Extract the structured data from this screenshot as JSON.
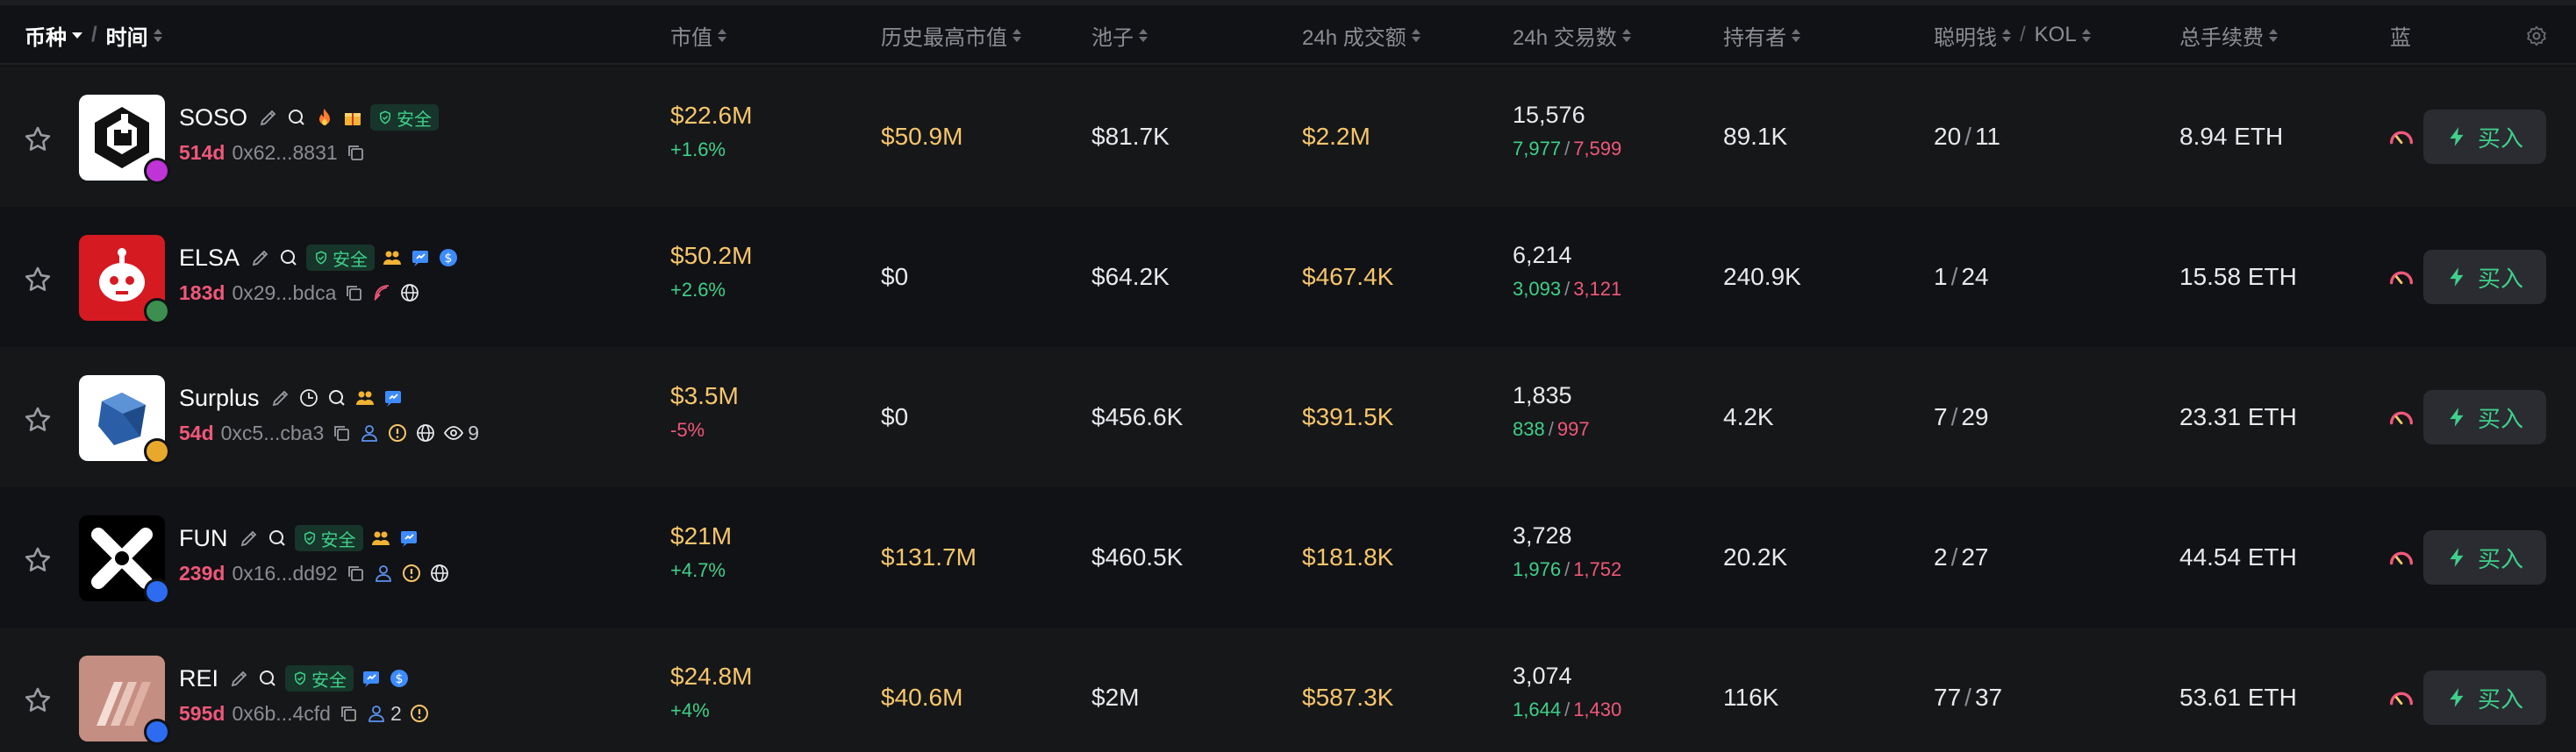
{
  "header": {
    "token": "币种",
    "time": "时间",
    "market_cap": "市值",
    "ath_market_cap": "历史最高市值",
    "pool": "池子",
    "volume_24h": "24h 成交额",
    "txs_24h": "24h 交易数",
    "holders": "持有者",
    "smart_money": "聪明钱",
    "kol": "KOL",
    "total_fees": "总手续费",
    "bluechip": "蓝"
  },
  "buy_label": "买入",
  "safe_label": "安全",
  "colors": {
    "green": "#3fd08a",
    "red": "#f0587a",
    "gold": "#f6c66b"
  },
  "rows": [
    {
      "symbol": "SOSO",
      "age": "514d",
      "address": "0x62...8831",
      "market_cap": "$22.6M",
      "change": "+1.6%",
      "change_dir": "up",
      "ath": "$50.9M",
      "ath_gold": true,
      "pool": "$81.7K",
      "volume": "$2.2M",
      "txs": "15,576",
      "buys": "7,977",
      "sells": "7,599",
      "holders": "89.1K",
      "smart": "20",
      "kol": "11",
      "fees": "8.94 ETH",
      "chain_color": "#c033d6",
      "icons": [
        "edit-icon",
        "search-icon",
        "fire-icon",
        "gift-icon"
      ],
      "safe": true,
      "sub_icons": [
        "copy-icon"
      ]
    },
    {
      "symbol": "ELSA",
      "age": "183d",
      "address": "0x29...bdca",
      "market_cap": "$50.2M",
      "change": "+2.6%",
      "change_dir": "up",
      "ath": "$0",
      "ath_gold": false,
      "pool": "$64.2K",
      "volume": "$467.4K",
      "txs": "6,214",
      "buys": "3,093",
      "sells": "3,121",
      "holders": "240.9K",
      "smart": "1",
      "kol": "24",
      "fees": "15.58 ETH",
      "chain_color": "#3c8f4f",
      "icons": [
        "edit-icon",
        "search-icon"
      ],
      "safe": true,
      "post_icons": [
        "team-icon",
        "chat-icon",
        "dollar-icon"
      ],
      "sub_icons": [
        "copy-icon",
        "feather-icon",
        "globe-icon"
      ]
    },
    {
      "symbol": "Surplus",
      "age": "54d",
      "address": "0xc5...cba3",
      "market_cap": "$3.5M",
      "change": "-5%",
      "change_dir": "down",
      "ath": "$0",
      "ath_gold": false,
      "pool": "$456.6K",
      "volume": "$391.5K",
      "txs": "1,835",
      "buys": "838",
      "sells": "997",
      "holders": "4.2K",
      "smart": "7",
      "kol": "29",
      "fees": "23.31 ETH",
      "chain_color": "#e8a82c",
      "icons": [
        "edit-icon",
        "clock-icon",
        "search-icon",
        "team-icon",
        "chat-icon"
      ],
      "safe": false,
      "sub_icons": [
        "copy-icon",
        "user-icon",
        "warning-icon",
        "globe-icon",
        "eye-icon"
      ],
      "watchers": "9"
    },
    {
      "symbol": "FUN",
      "age": "239d",
      "address": "0x16...dd92",
      "market_cap": "$21M",
      "change": "+4.7%",
      "change_dir": "up",
      "ath": "$131.7M",
      "ath_gold": true,
      "pool": "$460.5K",
      "volume": "$181.8K",
      "txs": "3,728",
      "buys": "1,976",
      "sells": "1,752",
      "holders": "20.2K",
      "smart": "2",
      "kol": "27",
      "fees": "44.54 ETH",
      "chain_color": "#2d6cf0",
      "icons": [
        "edit-icon",
        "search-icon"
      ],
      "safe": true,
      "post_icons": [
        "team-icon",
        "chat-icon"
      ],
      "sub_icons": [
        "copy-icon",
        "user-icon",
        "warning-icon",
        "globe-icon"
      ]
    },
    {
      "symbol": "REI",
      "age": "595d",
      "address": "0x6b...4cfd",
      "market_cap": "$24.8M",
      "change": "+4%",
      "change_dir": "up",
      "ath": "$40.6M",
      "ath_gold": true,
      "pool": "$2M",
      "volume": "$587.3K",
      "txs": "3,074",
      "buys": "1,644",
      "sells": "1,430",
      "holders": "116K",
      "smart": "77",
      "kol": "37",
      "fees": "53.61 ETH",
      "chain_color": "#2d6cf0",
      "icons": [
        "edit-icon",
        "search-icon"
      ],
      "safe": true,
      "post_icons": [
        "chat-icon",
        "dollar-icon"
      ],
      "sub_icons": [
        "copy-icon",
        "user-icon",
        "warning-icon"
      ],
      "holders_count": "2"
    }
  ]
}
